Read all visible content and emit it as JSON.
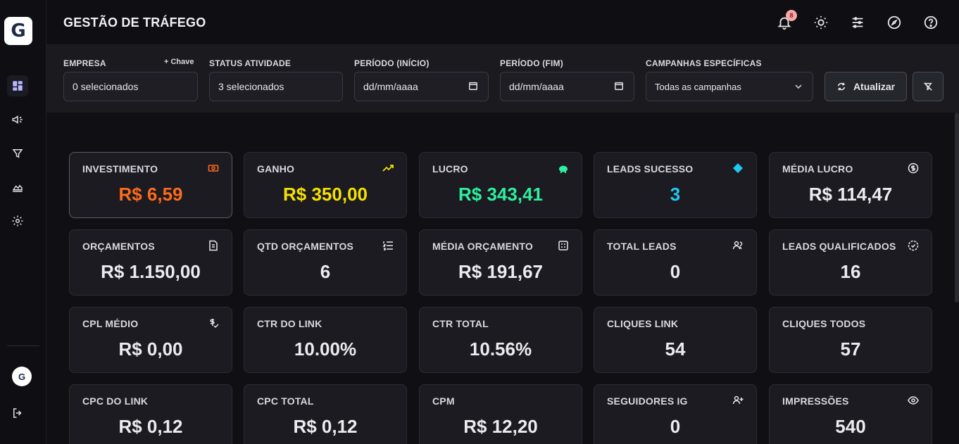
{
  "app": {
    "logo_letter": "G",
    "avatar_letter": "G"
  },
  "header": {
    "title": "GESTÃO DE TRÁFEGO",
    "notifications_count": "8"
  },
  "sidebar": {
    "items": [
      {
        "name": "dashboard",
        "icon": "dashboard-icon",
        "active": true
      },
      {
        "name": "campaigns",
        "icon": "megaphone-icon",
        "active": false
      },
      {
        "name": "funnel",
        "icon": "filter-icon",
        "active": false
      },
      {
        "name": "reports",
        "icon": "chart-area-icon",
        "active": false
      },
      {
        "name": "settings",
        "icon": "gear-icon",
        "active": false
      }
    ]
  },
  "filters": {
    "empresa": {
      "label": "EMPRESA",
      "value": "0 selecionados",
      "add_key": "+ Chave"
    },
    "status": {
      "label": "STATUS ATIVIDADE",
      "value": "3 selecionados"
    },
    "periodo_inicio": {
      "label": "PERÍODO (INÍCIO)",
      "value": "dd/mm/aaaa"
    },
    "periodo_fim": {
      "label": "PERÍODO (FIM)",
      "value": "dd/mm/aaaa"
    },
    "campanhas": {
      "label": "CAMPANHAS ESPECÍFICAS",
      "value": "Todas as campanhas"
    },
    "refresh_label": "Atualizar"
  },
  "colors": {
    "investimento": "#ff6a1a",
    "ganho": "#f5e000",
    "lucro": "#2ef0a0",
    "leads_sucesso": "#20c8f0",
    "default": "#ececf0"
  },
  "cards": [
    {
      "label": "INVESTIMENTO",
      "value": "R$ 6,59",
      "icon": "money-icon"
    },
    {
      "label": "GANHO",
      "value": "R$ 350,00",
      "icon": "trending-up-icon"
    },
    {
      "label": "LUCRO",
      "value": "R$ 343,41",
      "icon": "piggy-bank-icon"
    },
    {
      "label": "LEADS SUCESSO",
      "value": "3",
      "icon": "diamond-icon"
    },
    {
      "label": "MÉDIA LUCRO",
      "value": "R$ 114,47",
      "icon": "dollar-circle-icon"
    },
    {
      "label": "ORÇAMENTOS",
      "value": "R$ 1.150,00",
      "icon": "invoice-icon"
    },
    {
      "label": "QTD ORÇAMENTOS",
      "value": "6",
      "icon": "list-numbered-icon"
    },
    {
      "label": "MÉDIA ORÇAMENTO",
      "value": "R$ 191,67",
      "icon": "calculator-icon"
    },
    {
      "label": "TOTAL LEADS",
      "value": "0",
      "icon": "users-icon"
    },
    {
      "label": "LEADS QUALIFICADOS",
      "value": "16",
      "icon": "badge-check-icon"
    },
    {
      "label": "CPL MÉDIO",
      "value": "R$ 0,00",
      "icon": "dollar-check-icon"
    },
    {
      "label": "CTR DO LINK",
      "value": "10.00%",
      "icon": ""
    },
    {
      "label": "CTR TOTAL",
      "value": "10.56%",
      "icon": ""
    },
    {
      "label": "CLIQUES LINK",
      "value": "54",
      "icon": ""
    },
    {
      "label": "CLIQUES TODOS",
      "value": "57",
      "icon": ""
    },
    {
      "label": "CPC DO LINK",
      "value": "R$ 0,12",
      "icon": ""
    },
    {
      "label": "CPC TOTAL",
      "value": "R$ 0,12",
      "icon": ""
    },
    {
      "label": "CPM",
      "value": "R$ 12,20",
      "icon": ""
    },
    {
      "label": "SEGUIDORES IG",
      "value": "0",
      "icon": "user-plus-icon"
    },
    {
      "label": "IMPRESSÕES",
      "value": "540",
      "icon": "eye-icon"
    }
  ]
}
